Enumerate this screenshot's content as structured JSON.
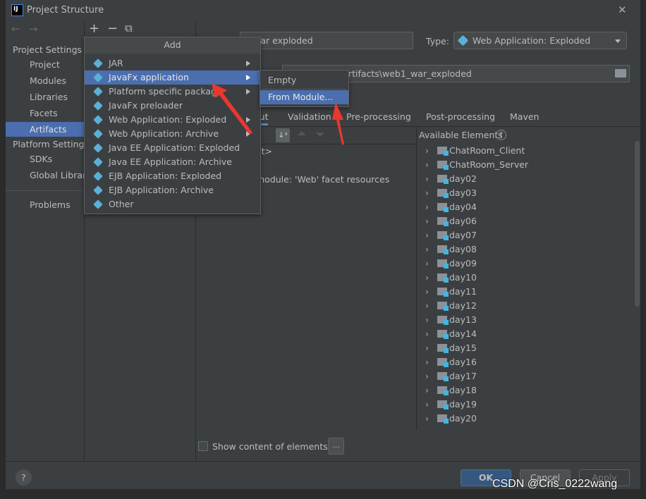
{
  "window": {
    "title": "Project Structure",
    "close": "✕",
    "logo": "IJ"
  },
  "sidebar": {
    "project_settings": "Project Settings",
    "items": [
      {
        "label": "Project"
      },
      {
        "label": "Modules"
      },
      {
        "label": "Libraries"
      },
      {
        "label": "Facets"
      },
      {
        "label": "Artifacts",
        "selected": true
      }
    ],
    "platform_settings": "Platform Settings",
    "platform_items": [
      {
        "label": "SDKs"
      },
      {
        "label": "Global Libraries"
      }
    ],
    "problems": "Problems"
  },
  "toolbar": {
    "add": "+",
    "remove": "−",
    "copy": "⧉",
    "back": "←",
    "forward": "→"
  },
  "artifact": {
    "name_value": "1:war exploded",
    "type_label": "Type:",
    "type_value": "Web Application: Exploded",
    "output_dir": "C:\\...\\artifacts\\web1_war_exploded",
    "output_visible": "\\artifacts\\web1_war_exploded"
  },
  "add_menu": {
    "title": "Add",
    "items": [
      {
        "label": "JAR",
        "submenu": true
      },
      {
        "label": "JavaFx application",
        "submenu": true,
        "highlighted": true
      },
      {
        "label": "Platform specific package",
        "submenu": true
      },
      {
        "label": "JavaFx preloader",
        "submenu": false
      },
      {
        "label": "Web Application: Exploded",
        "submenu": true
      },
      {
        "label": "Web Application: Archive",
        "submenu": true
      },
      {
        "label": "Java EE Application: Exploded",
        "submenu": false
      },
      {
        "label": "Java EE Application: Archive",
        "submenu": false
      },
      {
        "label": "EJB Application: Exploded",
        "submenu": false
      },
      {
        "label": "EJB Application: Archive",
        "submenu": false
      },
      {
        "label": "Other",
        "submenu": false
      }
    ]
  },
  "submenu": {
    "items": [
      {
        "label": "Empty"
      },
      {
        "label": "From Module...",
        "highlighted": true
      }
    ]
  },
  "tabs": [
    {
      "label": "out"
    },
    {
      "label": "Validation"
    },
    {
      "label": "Pre-processing"
    },
    {
      "label": "Post-processing"
    },
    {
      "label": "Maven"
    }
  ],
  "layout_tree": [
    "ot>",
    ":",
    "module: 'Web' facet resources"
  ],
  "available": {
    "title": "Available Elements",
    "help": "?",
    "items": [
      "ChatRoom_Client",
      "ChatRoom_Server",
      "day02",
      "day03",
      "day04",
      "day06",
      "day07",
      "day08",
      "day09",
      "day10",
      "day11",
      "day12",
      "day13",
      "day14",
      "day15",
      "day16",
      "day17",
      "day18",
      "day19",
      "day20"
    ]
  },
  "bottom": {
    "show_content": "Show content of elements",
    "more": "...",
    "help": "?",
    "ok": "OK",
    "cancel": "Cancel",
    "apply": "Apply"
  },
  "watermark": "CSDN @Cris_0222wang",
  "colors": {
    "selection": "#4b6eaf",
    "background": "#3c3f41",
    "annotation_arrow": "#e8382f"
  }
}
